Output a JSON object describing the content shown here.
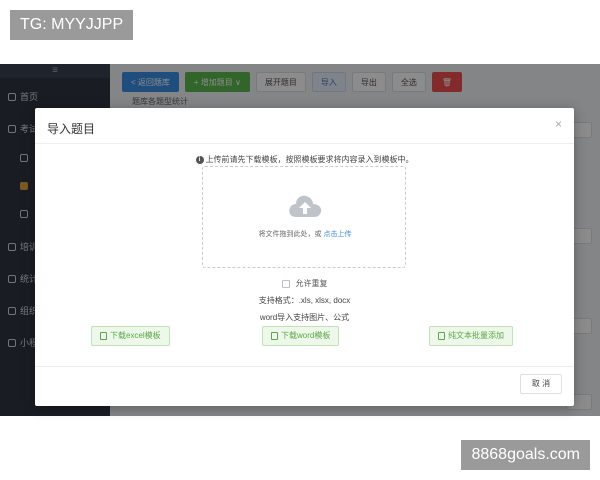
{
  "watermarks": {
    "top_left": "TG: MYYJJPP",
    "bottom_right": "8868goals.com"
  },
  "sidebar": {
    "menu_icon": "≡",
    "items": [
      {
        "label": "首页"
      },
      {
        "label": "考试"
      },
      {
        "label": "培训"
      },
      {
        "label": "统计"
      },
      {
        "label": "组织"
      },
      {
        "label": "小程"
      }
    ]
  },
  "toolbar": {
    "back": "< 返回题库",
    "add": "+ 增加题目 ∨",
    "expand": "展开题目",
    "import": "导入",
    "export": "导出",
    "select_all": "全选",
    "delete": "🗑"
  },
  "main": {
    "subtitle": "题库各题型统计"
  },
  "dialog": {
    "title": "导入题目",
    "close": "×",
    "tip": "上传前请先下载模板，按照模板要求将内容录入到模板中。",
    "upload_text": "将文件拖到此处，或 ",
    "upload_link": "点击上传",
    "allow_duplicate": "允许重复",
    "formats": "支持格式：.xls, xlsx, docx",
    "word_tip": "word导入支持图片、公式",
    "download_excel": "下载excel模板",
    "download_word": "下载word模板",
    "plain_text": "纯文本批量添加",
    "cancel": "取 消"
  },
  "colors": {
    "primary": "#3a8ee6",
    "green": "#5ab84c",
    "danger": "#ef4f4f"
  }
}
